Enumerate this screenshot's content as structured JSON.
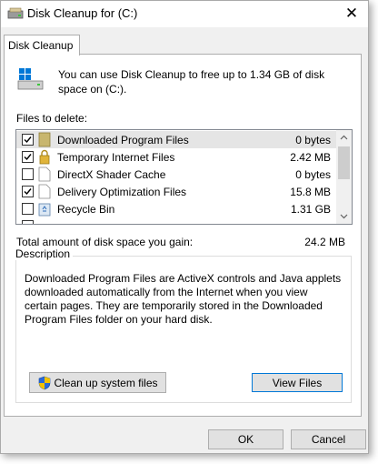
{
  "window": {
    "title": "Disk Cleanup for  (C:)",
    "close_symbol": "✕"
  },
  "tab": {
    "label": "Disk Cleanup"
  },
  "intro": {
    "text": "You can use Disk Cleanup to free up to 1.34 GB of disk space on  (C:)."
  },
  "files": {
    "label": "Files to delete:",
    "items": [
      {
        "name": "Downloaded Program Files",
        "size": "0 bytes",
        "checked": true,
        "icon": "folder-icon",
        "selected": true
      },
      {
        "name": "Temporary Internet Files",
        "size": "2.42 MB",
        "checked": true,
        "icon": "lock-icon",
        "selected": false
      },
      {
        "name": "DirectX Shader Cache",
        "size": "0 bytes",
        "checked": false,
        "icon": "file-icon",
        "selected": false
      },
      {
        "name": "Delivery Optimization Files",
        "size": "15.8 MB",
        "checked": true,
        "icon": "file-icon",
        "selected": false
      },
      {
        "name": "Recycle Bin",
        "size": "1.31 GB",
        "checked": false,
        "icon": "recycle-bin-icon",
        "selected": false
      }
    ]
  },
  "total": {
    "label": "Total amount of disk space you gain:",
    "value": "24.2 MB"
  },
  "description": {
    "legend": "Description",
    "text": "Downloaded Program Files are ActiveX controls and Java applets downloaded automatically from the Internet when you view certain pages. They are temporarily stored in the Downloaded Program Files folder on your hard disk."
  },
  "buttons": {
    "cleanup_system": "Clean up system files",
    "view_files": "View Files",
    "ok": "OK",
    "cancel": "Cancel"
  },
  "colors": {
    "accent": "#0078d7",
    "selected_row": "#e5e5e5"
  }
}
